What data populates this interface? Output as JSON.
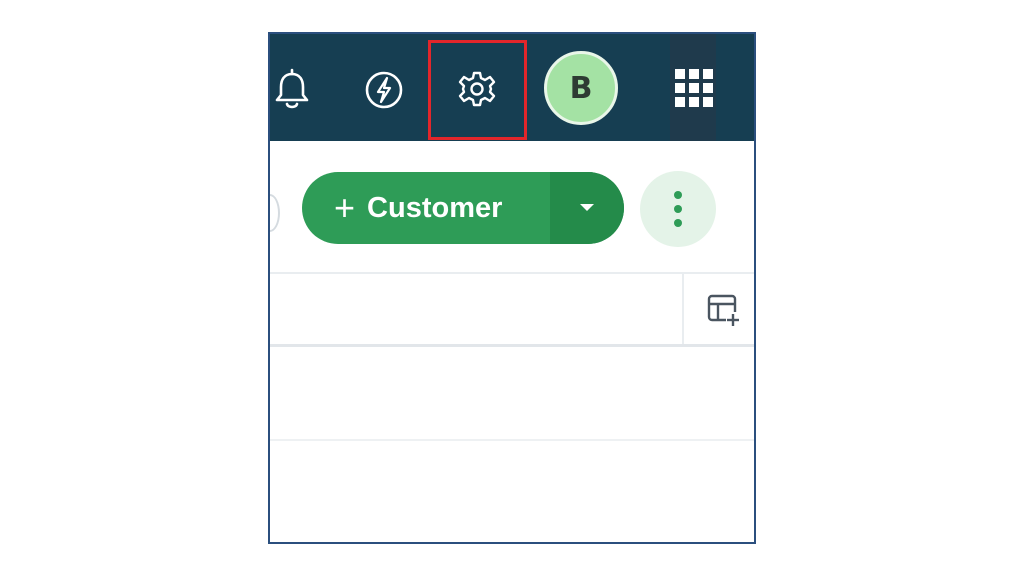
{
  "header": {
    "icons": {
      "notifications": "bell-icon",
      "quick_actions": "bolt-icon",
      "settings": "gear-icon",
      "apps": "grid-icon"
    },
    "highlighted_icon": "gear-icon",
    "avatar_initial": "B",
    "colors": {
      "topbar": "#163e52",
      "highlight": "#e3262b",
      "avatar": "#a4e2a4"
    }
  },
  "actions": {
    "add_customer_label": "Customer",
    "plus_symbol": "+",
    "colors": {
      "primary": "#2e9c57",
      "primary_dark": "#248b4a",
      "more_bg": "#e4f3e8"
    }
  },
  "table": {
    "toolbar_icon": "table-add-column-icon"
  }
}
